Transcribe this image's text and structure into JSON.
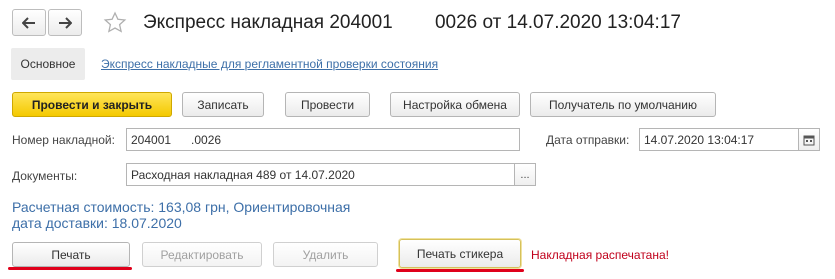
{
  "header": {
    "title": "Экспресс накладная 204001        0026 от 14.07.2020 13:04:17",
    "back_icon": "arrow-left-icon",
    "forward_icon": "arrow-right-icon",
    "favorite_icon": "star-icon"
  },
  "nav": {
    "main_tab": "Основное",
    "link": "Экспресс накладные для регламентной проверки состояния"
  },
  "toolbar": {
    "post_close": "Провести и закрыть",
    "save": "Записать",
    "post": "Провести",
    "exchange_settings": "Настройка обмена",
    "default_recipient": "Получатель по умолчанию"
  },
  "form": {
    "invoice_number_label": "Номер накладной:",
    "invoice_number_value": "204001      .0026",
    "send_date_label": "Дата отправки:",
    "send_date_value": "14.07.2020 13:04:17",
    "documents_label": "Документы:",
    "documents_value": "Расходная накладная 489 от 14.07.2020",
    "documents_select": "..."
  },
  "info": {
    "estimated_cost": "Расчетная стоимость:    163,08 грн, Ориентировочная",
    "delivery_date": "дата доставки: 18.07.2020"
  },
  "actions": {
    "print": "Печать",
    "edit": "Редактировать",
    "delete": "Удалить",
    "print_sticker": "Печать стикера",
    "status": "Накладная распечатана!"
  },
  "colors": {
    "accent_yellow": "#f4c900",
    "link_blue": "#3d6fa8",
    "status_red": "#c0001b",
    "underline_red": "#e0001b"
  }
}
